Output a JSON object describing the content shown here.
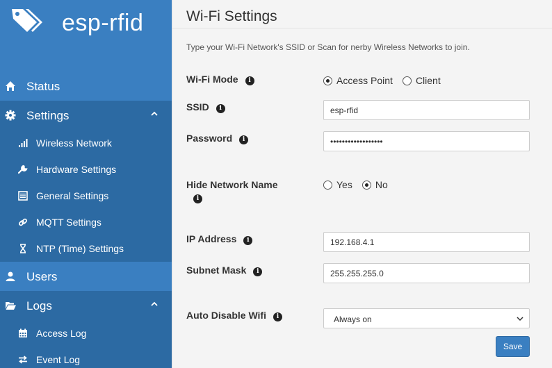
{
  "sidebar": {
    "brand": "esp-rfid",
    "status": "Status",
    "settings": "Settings",
    "settings_items": [
      "Wireless Network",
      "Hardware Settings",
      "General Settings",
      "MQTT Settings",
      "NTP (Time) Settings"
    ],
    "users": "Users",
    "logs": "Logs",
    "logs_items": [
      "Access Log",
      "Event Log"
    ]
  },
  "main": {
    "title": "Wi-Fi Settings",
    "description": "Type your Wi-Fi Network's SSID or Scan for nerby Wireless Networks to join.",
    "wifi_mode": {
      "label": "Wi-Fi Mode",
      "options": [
        "Access Point",
        "Client"
      ],
      "selected": "Access Point"
    },
    "ssid": {
      "label": "SSID",
      "value": "esp-rfid"
    },
    "password": {
      "label": "Password",
      "value": "••••••••••••••••••"
    },
    "hide_network": {
      "label": "Hide Network Name",
      "options": [
        "Yes",
        "No"
      ],
      "selected": "No"
    },
    "ip_address": {
      "label": "IP Address",
      "value": "192.168.4.1"
    },
    "subnet_mask": {
      "label": "Subnet Mask",
      "value": "255.255.255.0"
    },
    "auto_disable": {
      "label": "Auto Disable Wifi",
      "value": "Always on"
    },
    "save_label": "Save"
  },
  "colors": {
    "sidebar": "#2c6aa3",
    "sidebar_highlight": "#3a7fc1",
    "button": "#3a7fc1"
  }
}
